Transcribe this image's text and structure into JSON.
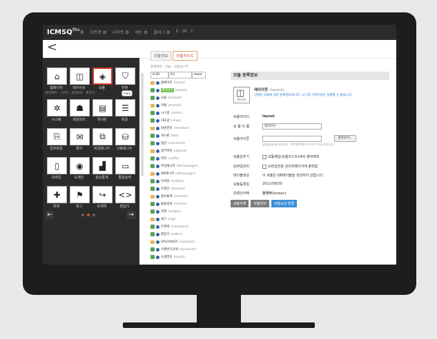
{
  "topbar": {
    "brand": "ICMSQ",
    "brand_sup": "fits",
    "menu": [
      "홈",
      "이트판 ✪",
      "사이트 ✪",
      "캐논 ✪",
      "플러그 ✪",
      "E · W · C"
    ]
  },
  "nav": {
    "back_label": "<"
  },
  "tiles": [
    {
      "glyph": "⌂",
      "label": "홈페이지",
      "icon": "home-icon",
      "active": false
    },
    {
      "glyph": "◫",
      "label": "레이아웃",
      "icon": "layout-icon",
      "active": false
    },
    {
      "glyph": "◈",
      "label": "모듈",
      "icon": "module-icon",
      "active": true
    },
    {
      "glyph": "⛉",
      "label": "위젯",
      "icon": "widget-icon",
      "active": false
    },
    {
      "glyph": "✲",
      "label": "시스템",
      "icon": "system-icon",
      "active": false
    },
    {
      "glyph": "☗",
      "label": "회원관리",
      "icon": "members-icon",
      "active": false
    },
    {
      "glyph": "▤",
      "label": "게시판",
      "icon": "board-icon",
      "active": false
    },
    {
      "glyph": "☰",
      "label": "댓글",
      "icon": "comments-icon",
      "active": false
    },
    {
      "glyph": "⎘",
      "label": "업무파일",
      "icon": "files-icon",
      "active": false
    },
    {
      "glyph": "✉",
      "label": "쪽지",
      "icon": "message-icon",
      "active": false
    },
    {
      "glyph": "⧉",
      "label": "파일매니저",
      "icon": "filemanager-icon",
      "active": false
    },
    {
      "glyph": "⛁",
      "label": "DB매니저",
      "icon": "db-icon",
      "active": false
    },
    {
      "glyph": "▯",
      "label": "모바일",
      "icon": "mobile-icon",
      "active": false
    },
    {
      "glyph": "◉",
      "label": "도메인",
      "icon": "domain-icon",
      "active": false
    },
    {
      "glyph": "▟",
      "label": "접속통계",
      "icon": "stats-icon",
      "active": false
    },
    {
      "glyph": "▭",
      "label": "통합검색",
      "icon": "search-icon",
      "active": false
    },
    {
      "glyph": "✚",
      "label": "위젯",
      "icon": "puzzle-icon",
      "active": false
    },
    {
      "glyph": "⚑",
      "label": "태그",
      "icon": "tag-icon",
      "active": false
    },
    {
      "glyph": "↪",
      "label": "트랙백",
      "icon": "trackback-icon",
      "active": false
    },
    {
      "glyph": "<>",
      "label": "편집기",
      "icon": "code-icon",
      "active": false
    }
  ],
  "filter": {
    "text": "환경제어 · 스위치 · 업데이트 · 편리지",
    "pill": "more"
  },
  "carousel": {
    "prev": "←",
    "next": "→"
  },
  "tabs": [
    {
      "label": "모듈정보",
      "active": false
    },
    {
      "label": "모듈리스트",
      "active": true
    }
  ],
  "breadcrumb": "환경제어 › 모듈 › 모듈리스트",
  "list_controls": {
    "sort": "0.30",
    "page": "P.1",
    "more": "more"
  },
  "modules": [
    {
      "name": "홈페이지",
      "tag": "(home)",
      "hl": false
    },
    {
      "name": "레이아웃",
      "tag": "(layout)",
      "hl": true
    },
    {
      "name": "모듈",
      "tag": "(module)",
      "hl": false
    },
    {
      "name": "마켓",
      "tag": "(market)",
      "hl": false
    },
    {
      "name": "시스템",
      "tag": "(admin)",
      "hl": false
    },
    {
      "name": "FBC값",
      "tag": "(shop)",
      "hl": false
    },
    {
      "name": "회원관리",
      "tag": "(member)",
      "hl": false
    },
    {
      "name": "게시판",
      "tag": "(bbs)",
      "hl": false
    },
    {
      "name": "댓글",
      "tag": "(comment)",
      "hl": false
    },
    {
      "name": "업무파일",
      "tag": "(upload)",
      "hl": false
    },
    {
      "name": "쪽지",
      "tag": "(notify)",
      "hl": false
    },
    {
      "name": "파일매니저",
      "tag": "(filemanager)",
      "hl": false
    },
    {
      "name": "DB매니저",
      "tag": "(dbmanager)",
      "hl": false
    },
    {
      "name": "모바일",
      "tag": "(mobile)",
      "hl": false
    },
    {
      "name": "도메인",
      "tag": "(domain)",
      "hl": false
    },
    {
      "name": "접속통계",
      "tag": "(counter)",
      "hl": false
    },
    {
      "name": "통합검색",
      "tag": "(search)",
      "hl": false
    },
    {
      "name": "위젯",
      "tag": "(widget)",
      "hl": false
    },
    {
      "name": "태그",
      "tag": "(tag)",
      "hl": false
    },
    {
      "name": "트랙백",
      "tag": "(trackback)",
      "hl": false
    },
    {
      "name": "편집기",
      "tag": "(editor)",
      "hl": false
    },
    {
      "name": "UPLOADER",
      "tag": "(uploader)",
      "hl": false
    },
    {
      "name": "우편번호검색",
      "tag": "(zipsearch)",
      "hl": false
    },
    {
      "name": "소셜연동",
      "tag": "(social)",
      "hl": false
    }
  ],
  "panel": {
    "title": "모듈 등록정보",
    "icon_label": "레이아웃",
    "module_name": "레이아웃",
    "module_id": "(layout)",
    "desc": "선택된 모듈에 대한 등록정보입니다. 시스템 기본모듈은 삭제할 수 없습니다.",
    "fields": {
      "id_label": "모듈아이디",
      "id_value": "layout",
      "name_label": "모 듈 이 름",
      "name_value": "레이아웃",
      "icon_label": "모듈아이콘",
      "browse": "찾아보기...",
      "icon_hint": "gif/jpg/png 파일가능 · 60*60픽셀 사이즈로 자동조정됩니다",
      "hide_label": "모듈감추기",
      "hide_value": "모듈패널(모듈리스트)에서 출력제외",
      "mobile_label": "모바일관리",
      "mobile_value": "모바일전용 관리자페이지에 출력함",
      "db_label": "테이블생성",
      "db_value": "이 모듈은 DB테이블을 생성하지 않습니다.",
      "date_label": "모듈등록일",
      "date_value": "2012/08/30",
      "lang_label": "모범언어팩",
      "lang_value": "한국어",
      "lang_code": "(korean)"
    },
    "buttons": [
      "모듈삭제",
      "모듈관리",
      "모듈속성 변경"
    ]
  }
}
